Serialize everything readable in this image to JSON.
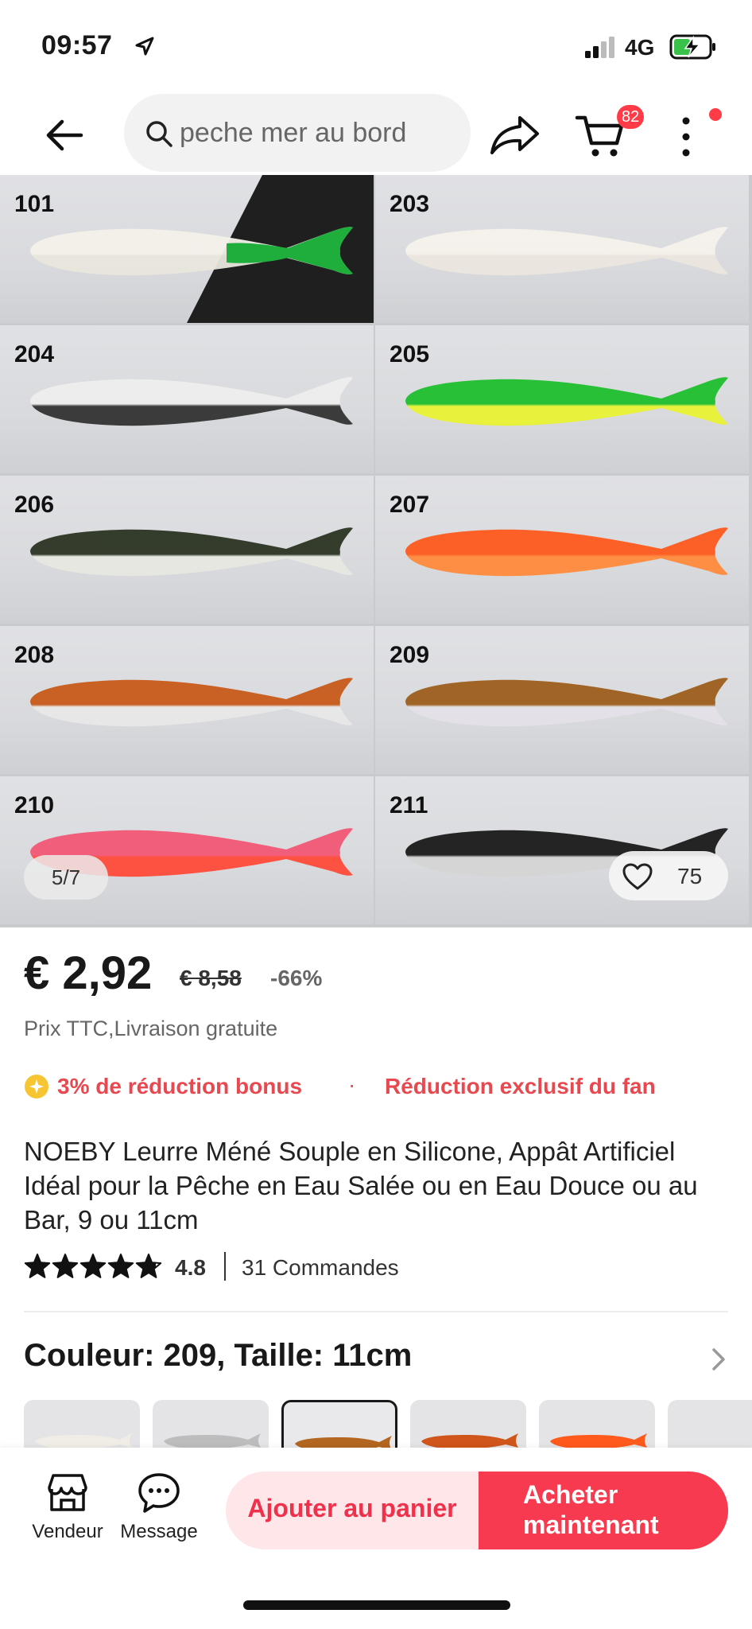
{
  "status_bar": {
    "time": "09:57",
    "network": "4G"
  },
  "nav": {
    "search_text": "peche mer au bord",
    "cart_count": "82"
  },
  "gallery": {
    "tiles": [
      {
        "label": "101",
        "colors": [
          "#f4f1ea",
          "#e9e6dd"
        ]
      },
      {
        "label": "203",
        "colors": [
          "#f6f2ec",
          "#ebe6df"
        ]
      },
      {
        "label": "204",
        "colors": [
          "#eeeeee",
          "#333333"
        ]
      },
      {
        "label": "205",
        "colors": [
          "#1fbf2e",
          "#e9f233"
        ]
      },
      {
        "label": "206",
        "colors": [
          "#2b3323",
          "#e8e8e2"
        ]
      },
      {
        "label": "207",
        "colors": [
          "#ff5a1c",
          "#ff8a3c"
        ]
      },
      {
        "label": "208",
        "colors": [
          "#c8591a",
          "#e8e8e8"
        ]
      },
      {
        "label": "209",
        "colors": [
          "#9d5e1c",
          "#e4e0e8"
        ]
      },
      {
        "label": "210",
        "colors": [
          "#f25876",
          "#ff4b3a"
        ]
      },
      {
        "label": "211",
        "colors": [
          "#1a1a1a",
          "#d5d5d5"
        ]
      }
    ],
    "counter": "5/7",
    "favorites": "75"
  },
  "price": {
    "current": "€ 2,92",
    "original": "€ 8,58",
    "discount": "-66%",
    "tax_note": "Prix TTC,Livraison gratuite"
  },
  "promos": {
    "bonus": "3% de réduction bonus",
    "separator": "·",
    "fan": "Réduction exclusif du fan"
  },
  "product": {
    "title": "NOEBY Leurre Méné Souple en Silicone, Appât Artificiel Idéal pour la Pêche en Eau Salée ou en Eau Douce ou au Bar, 9 ou 11cm",
    "rating": "4.8",
    "stars": 4.8,
    "orders": "31 Commandes"
  },
  "variant": {
    "title": "Couleur: 209, Taille: 11cm",
    "swatches": [
      {
        "color": "#f0ede6",
        "selected": false
      },
      {
        "color": "#bdbdbd",
        "selected": false
      },
      {
        "color": "#b3661f",
        "selected": true
      },
      {
        "color": "#d0551b",
        "selected": false
      },
      {
        "color": "#ff5a1c",
        "selected": false
      },
      {
        "color": "#ececec",
        "selected": false
      }
    ]
  },
  "bottom_bar": {
    "vendor_label": "Vendeur",
    "message_label": "Message",
    "add_to_cart": "Ajouter au panier",
    "buy_now": "Acheter maintenant"
  },
  "colors": {
    "accent": "#f73a4f",
    "accent_light": "#ffe6e8",
    "promo": "#e8484f"
  }
}
